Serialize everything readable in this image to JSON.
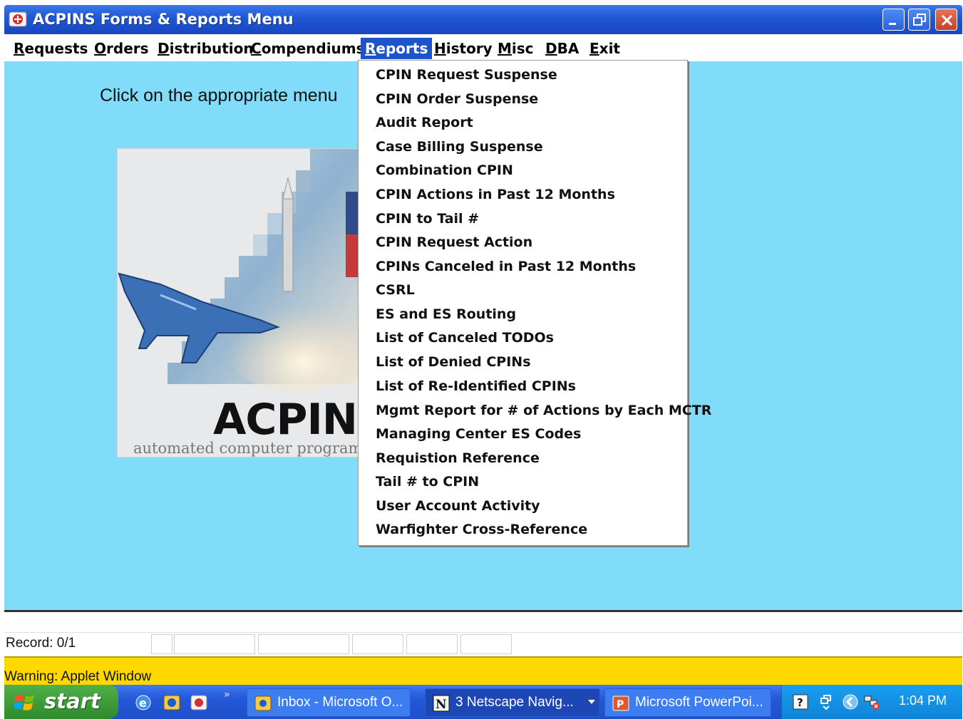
{
  "window": {
    "title": "ACPINS Forms & Reports Menu"
  },
  "menubar": {
    "items": [
      {
        "label_u": "R",
        "label_rest": "equests"
      },
      {
        "label_u": "O",
        "label_rest": "rders"
      },
      {
        "label_u": "D",
        "label_rest": "istribution"
      },
      {
        "label_u": "C",
        "label_rest": "ompendiums"
      },
      {
        "label_u": "R",
        "label_rest": "eports"
      },
      {
        "label_u": "H",
        "label_rest": "istory"
      },
      {
        "label_u": "M",
        "label_rest": "isc"
      },
      {
        "label_u": "D",
        "label_rest": "BA"
      },
      {
        "label_u": "E",
        "label_rest": "xit"
      }
    ]
  },
  "main": {
    "instruction": "Click on the appropriate menu",
    "logo_word": "ACPINS",
    "logo_subtitle": "automated computer program identification"
  },
  "reports_menu": {
    "items": [
      "CPIN Request Suspense",
      "CPIN Order Suspense",
      "Audit Report",
      "Case Billing Suspense",
      "Combination CPIN",
      "CPIN Actions in Past 12 Months",
      "CPIN to Tail #",
      "CPIN Request Action",
      "CPINs Canceled in Past 12 Months",
      "CSRL",
      "ES and ES Routing",
      "List of Canceled TODOs",
      "List of Denied CPINs",
      "List of Re-Identified CPINs",
      "Mgmt Report for # of Actions by Each MCTR",
      "Managing Center ES Codes",
      "Requistion Reference",
      "Tail # to CPIN",
      "User Account Activity",
      "Warfighter Cross-Reference"
    ]
  },
  "status": {
    "record": "Record: 0/1",
    "warning": "Warning: Applet Window"
  },
  "taskbar": {
    "start": "start",
    "tasks": [
      "Inbox - Microsoft O...",
      "3 Netscape Navig...",
      "Microsoft PowerPoi..."
    ],
    "clock": "1:04 PM"
  },
  "colors": {
    "client_bg": "#80dcf9",
    "menu_highlight": "#1d55c9",
    "warning_bg": "#ffd800"
  }
}
